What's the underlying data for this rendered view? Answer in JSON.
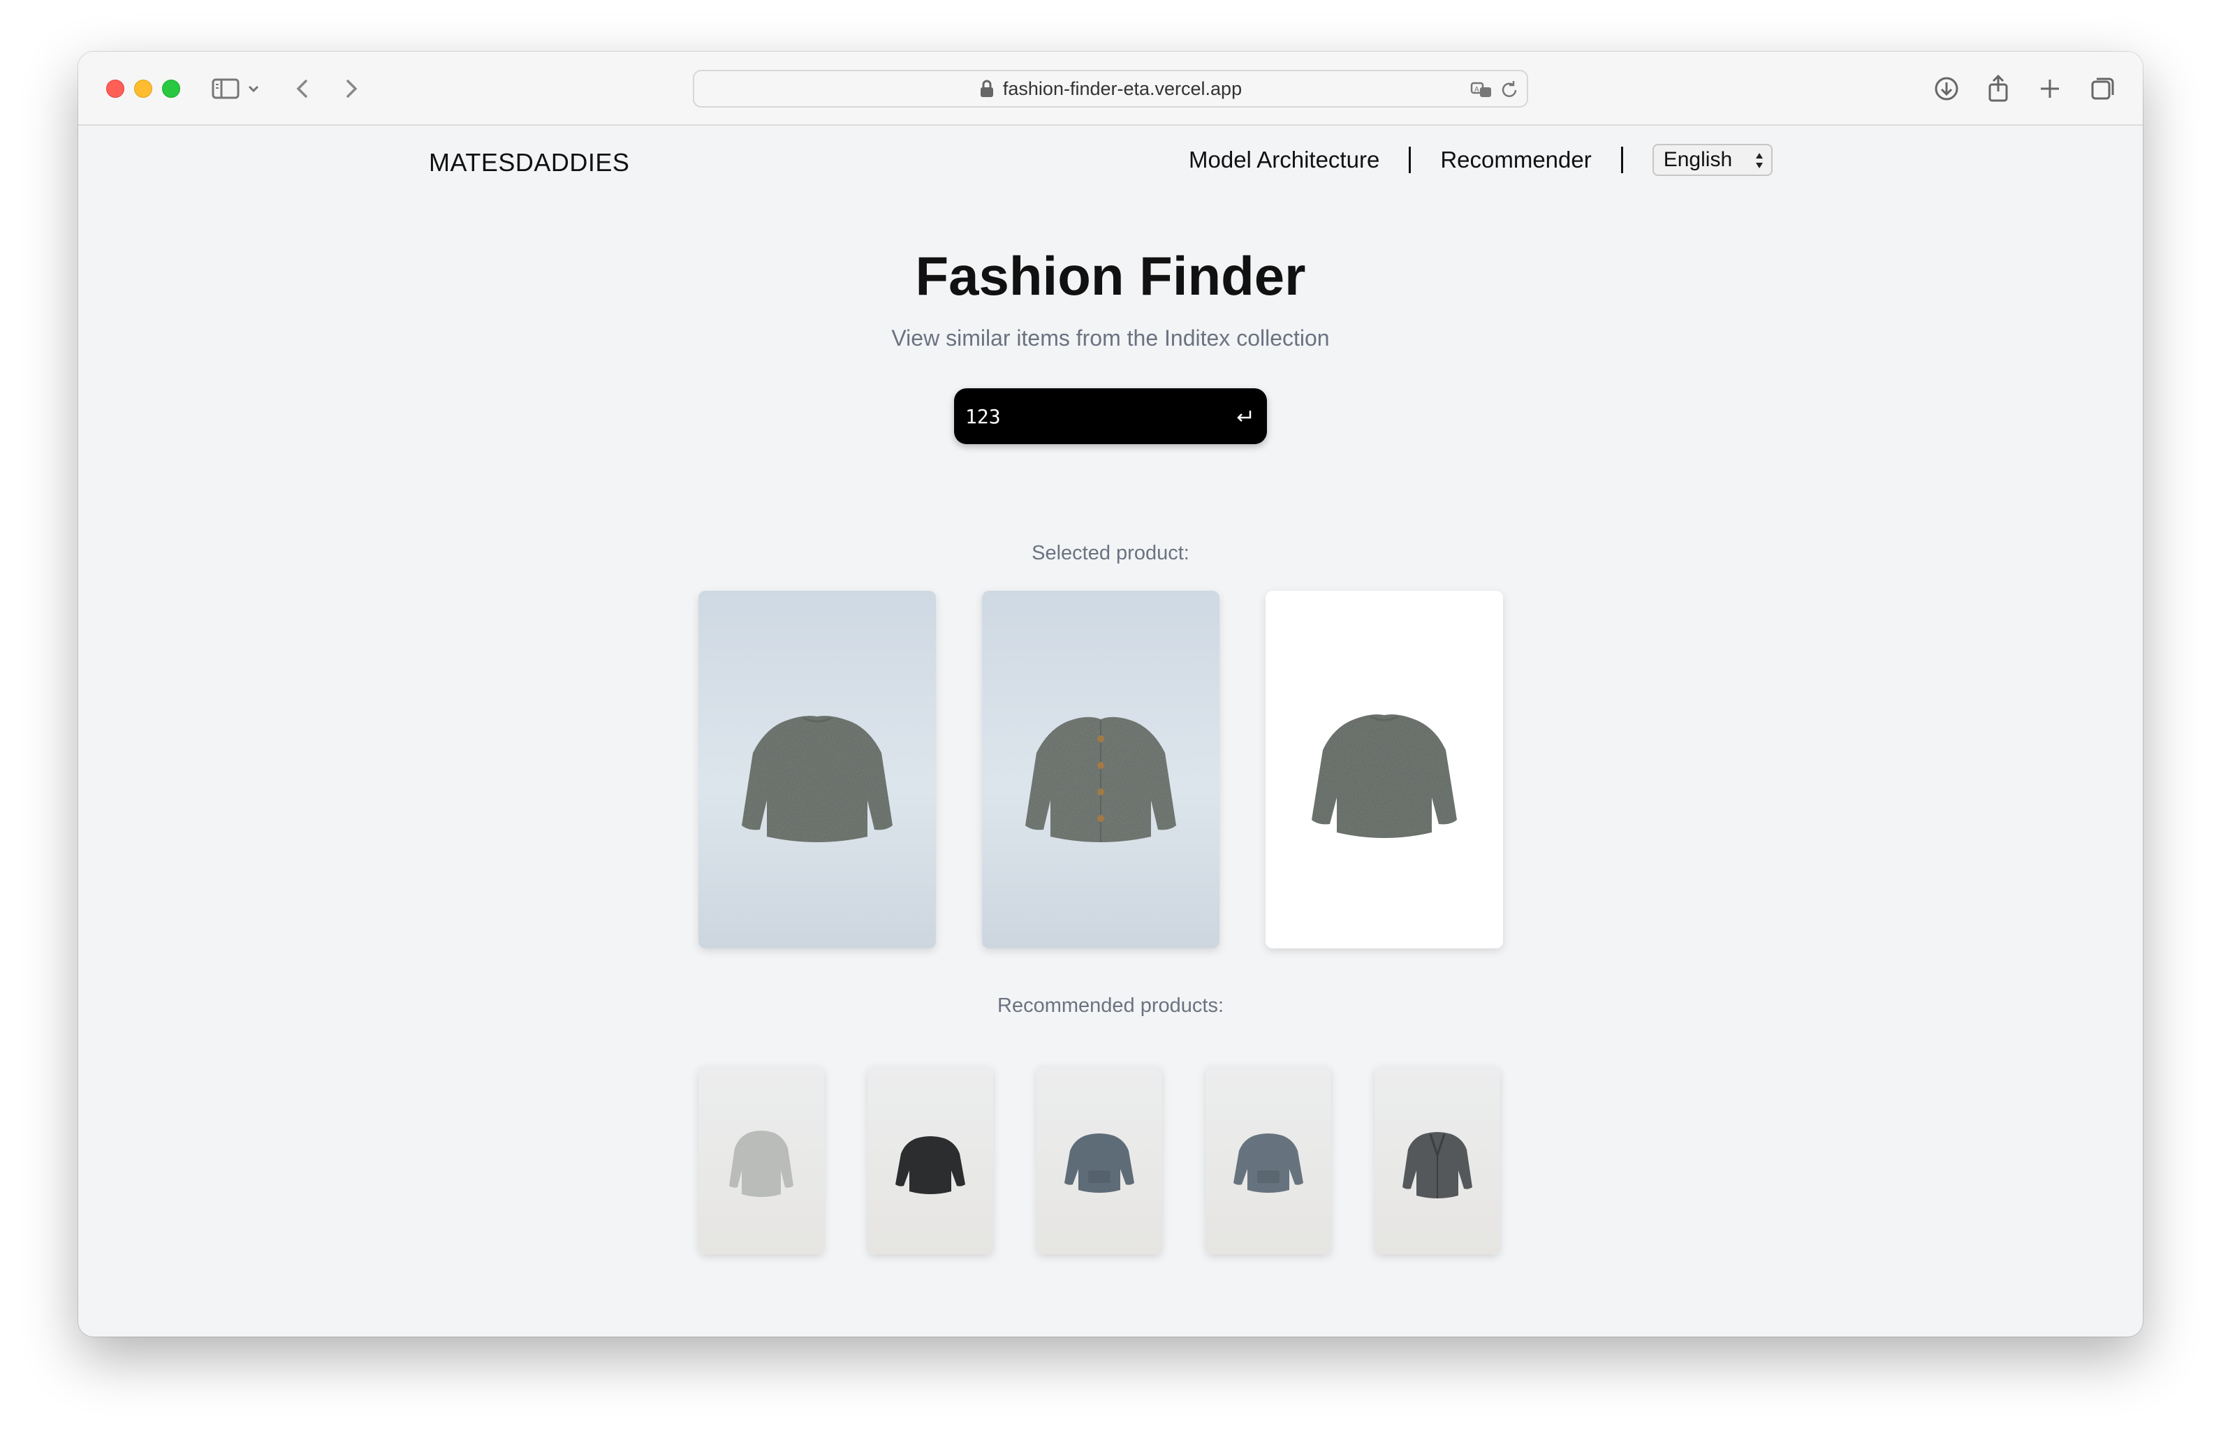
{
  "browser": {
    "url": "fashion-finder-eta.vercel.app"
  },
  "header": {
    "brand": "MATESDADDIES",
    "nav": [
      {
        "label": "Model Architecture"
      },
      {
        "label": "Recommender"
      }
    ],
    "language": {
      "selected": "English"
    }
  },
  "hero": {
    "title": "Fashion Finder",
    "subtitle": "View similar items from the Inditex collection"
  },
  "search": {
    "value": "123"
  },
  "selected": {
    "label": "Selected product:",
    "images": [
      {
        "icon": "grey-fleece-sweater-back",
        "background": "light-blue"
      },
      {
        "icon": "grey-fleece-cardigan-front",
        "background": "light-blue"
      },
      {
        "icon": "grey-fleece-sweater",
        "background": "white"
      }
    ]
  },
  "recommended": {
    "label": "Recommended products:",
    "items": [
      {
        "icon": "light-grey-sweater",
        "color": "#b9bcb8"
      },
      {
        "icon": "black-sweater",
        "color": "#2b2d2e"
      },
      {
        "icon": "blue-grey-sweater",
        "color": "#5e6c78"
      },
      {
        "icon": "blue-grey-sweater",
        "color": "#66737e"
      },
      {
        "icon": "grey-cardigan",
        "color": "#55585a"
      }
    ]
  }
}
